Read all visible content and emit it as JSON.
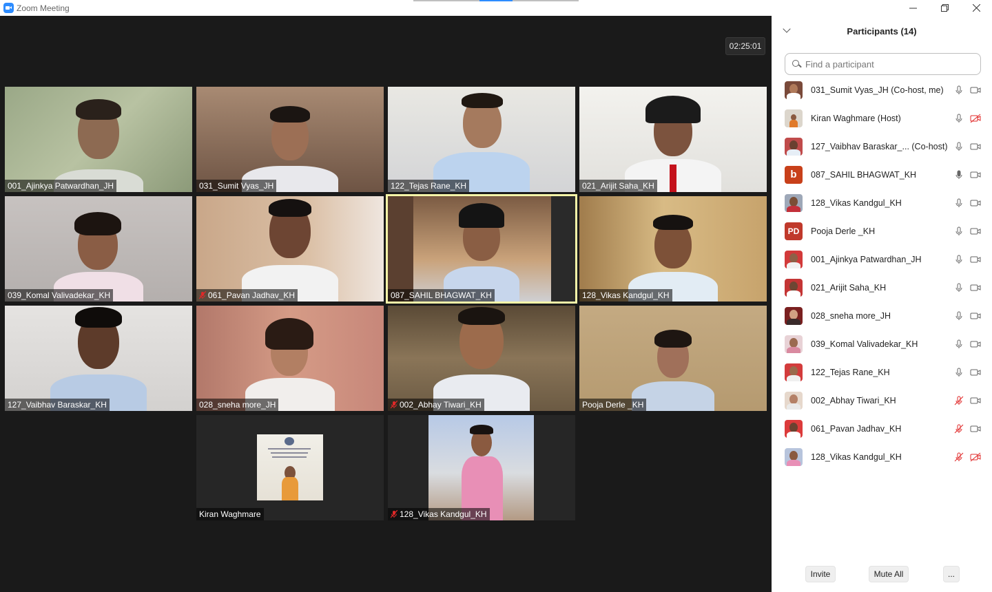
{
  "window": {
    "title": "Zoom Meeting"
  },
  "meeting": {
    "timer": "02:25:01"
  },
  "tiles": [
    {
      "name": "001_Ajinkya Patwardhan_JH",
      "muted": false
    },
    {
      "name": "031_Sumit Vyas_JH",
      "muted": false
    },
    {
      "name": "122_Tejas Rane_KH",
      "muted": false
    },
    {
      "name": "021_Arijit Saha_KH",
      "muted": false
    },
    {
      "name": "039_Komal Valivadekar_KH",
      "muted": false
    },
    {
      "name": "061_Pavan Jadhav_KH",
      "muted": true
    },
    {
      "name": "087_SAHIL BHAGWAT_KH",
      "muted": false,
      "active_speaker": true
    },
    {
      "name": "128_Vikas Kandgul_KH",
      "muted": false
    },
    {
      "name": "127_Vaibhav Baraskar_KH",
      "muted": false
    },
    {
      "name": "028_sneha more_JH",
      "muted": false
    },
    {
      "name": "002_Abhay Tiwari_KH",
      "muted": true
    },
    {
      "name": "Pooja Derle _KH",
      "muted": false
    },
    {
      "name": "Kiran Waghmare",
      "muted": false
    },
    {
      "name": "128_Vikas Kandgul_KH",
      "muted": true
    }
  ],
  "panel": {
    "title": "Participants (14)",
    "search_placeholder": "Find a participant",
    "participants": [
      {
        "name": "031_Sumit Vyas_JH (Co-host, me)",
        "avatar": "photo",
        "mic": "on",
        "video": "on"
      },
      {
        "name": "Kiran Waghmare (Host)",
        "avatar": "photo",
        "mic": "on",
        "video": "off"
      },
      {
        "name": "127_Vaibhav Baraskar_...   (Co-host)",
        "avatar": "photo",
        "mic": "on",
        "video": "on"
      },
      {
        "name": "087_SAHIL BHAGWAT_KH",
        "avatar": "b",
        "mic": "speaking",
        "video": "on"
      },
      {
        "name": "128_Vikas Kandgul_KH",
        "avatar": "photo",
        "mic": "on",
        "video": "on"
      },
      {
        "name": "Pooja Derle _KH",
        "avatar": "PD",
        "mic": "on",
        "video": "on"
      },
      {
        "name": "001_Ajinkya Patwardhan_JH",
        "avatar": "photo",
        "mic": "on",
        "video": "on"
      },
      {
        "name": "021_Arijit Saha_KH",
        "avatar": "photo",
        "mic": "on",
        "video": "on"
      },
      {
        "name": "028_sneha more_JH",
        "avatar": "photo",
        "mic": "on",
        "video": "on"
      },
      {
        "name": "039_Komal Valivadekar_KH",
        "avatar": "photo",
        "mic": "on",
        "video": "on"
      },
      {
        "name": "122_Tejas Rane_KH",
        "avatar": "photo",
        "mic": "on",
        "video": "on"
      },
      {
        "name": "002_Abhay Tiwari_KH",
        "avatar": "photo",
        "mic": "muted",
        "video": "on"
      },
      {
        "name": "061_Pavan Jadhav_KH",
        "avatar": "photo",
        "mic": "muted",
        "video": "on"
      },
      {
        "name": "128_Vikas Kandgul_KH",
        "avatar": "photo",
        "mic": "muted",
        "video": "off"
      }
    ],
    "invite_label": "Invite",
    "mute_all_label": "Mute All",
    "more_label": "..."
  },
  "colors": {
    "active_speaker_border": "#f5f5a8",
    "muted_red": "#e02828",
    "brand_blue": "#2d8cff",
    "avatar_b": "#c8401a",
    "avatar_pd": "#c0392b"
  }
}
